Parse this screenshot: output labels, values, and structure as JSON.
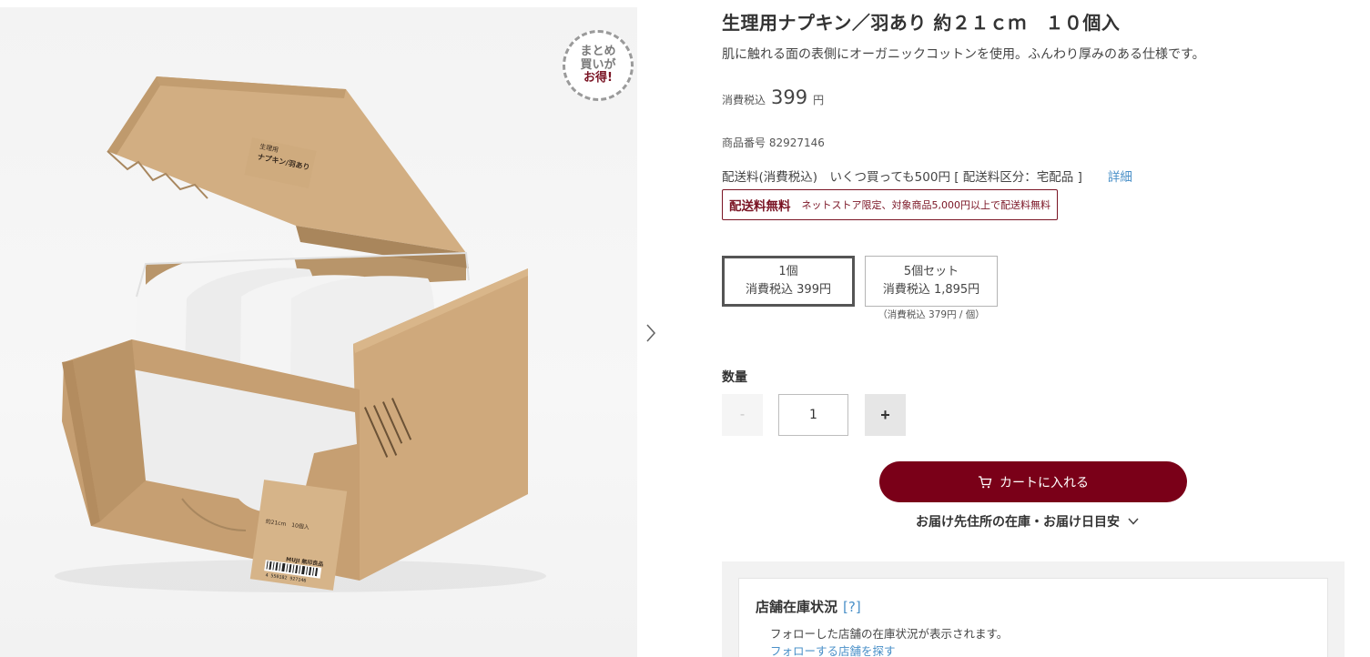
{
  "product": {
    "title": "生理用ナプキン／羽あり 約２１ｃｍ　１０個入",
    "description": "肌に触れる面の表側にオーガニックコットンを使用。ふんわり厚みのある仕様です。",
    "price_tax_label": "消費税込",
    "price": "399",
    "price_unit": "円",
    "sku": "商品番号 82927146"
  },
  "image": {
    "badge_line1": "まとめ",
    "badge_line2": "買いが",
    "badge_line3": "お得!",
    "box_label_line1": "生理用",
    "box_label_line2": "ナプキン/羽あり",
    "box_side_line1": "約21cm　10個入",
    "box_side_brand": "MUJI 無印良品",
    "barcode": "4 550182 927146"
  },
  "shipping": {
    "text": "配送料(消費税込)　いくつ買っても500円 [ 配送料区分：宅配品 ]",
    "detail_link": "詳細",
    "free_label": "配送料無料",
    "free_text": "ネットストア限定、対象商品5,000円以上で配送料無料"
  },
  "options": [
    {
      "name": "1個",
      "price": "消費税込 399円",
      "selected": true
    },
    {
      "name": "5個セット",
      "price": "消費税込 1,895円",
      "sub": "（消費税込 379円 / 個）",
      "selected": false
    }
  ],
  "quantity": {
    "label": "数量",
    "minus": "-",
    "value": "1",
    "plus": "+"
  },
  "cart": {
    "button_label": "カートに入れる",
    "delivery_toggle": "お届け先住所の在庫・お届け日目安"
  },
  "store_stock": {
    "title": "店舗在庫状況",
    "help": "[?]",
    "text": "フォローした店舗の在庫状況が表示されます。",
    "link": "フォローする店舗を探す"
  },
  "colors": {
    "accent": "#7a0018",
    "link": "#4a90c8",
    "cardboard": "#c9a57a"
  },
  "icons": [
    "chevron-right-icon",
    "cart-icon",
    "chevron-down-icon"
  ]
}
